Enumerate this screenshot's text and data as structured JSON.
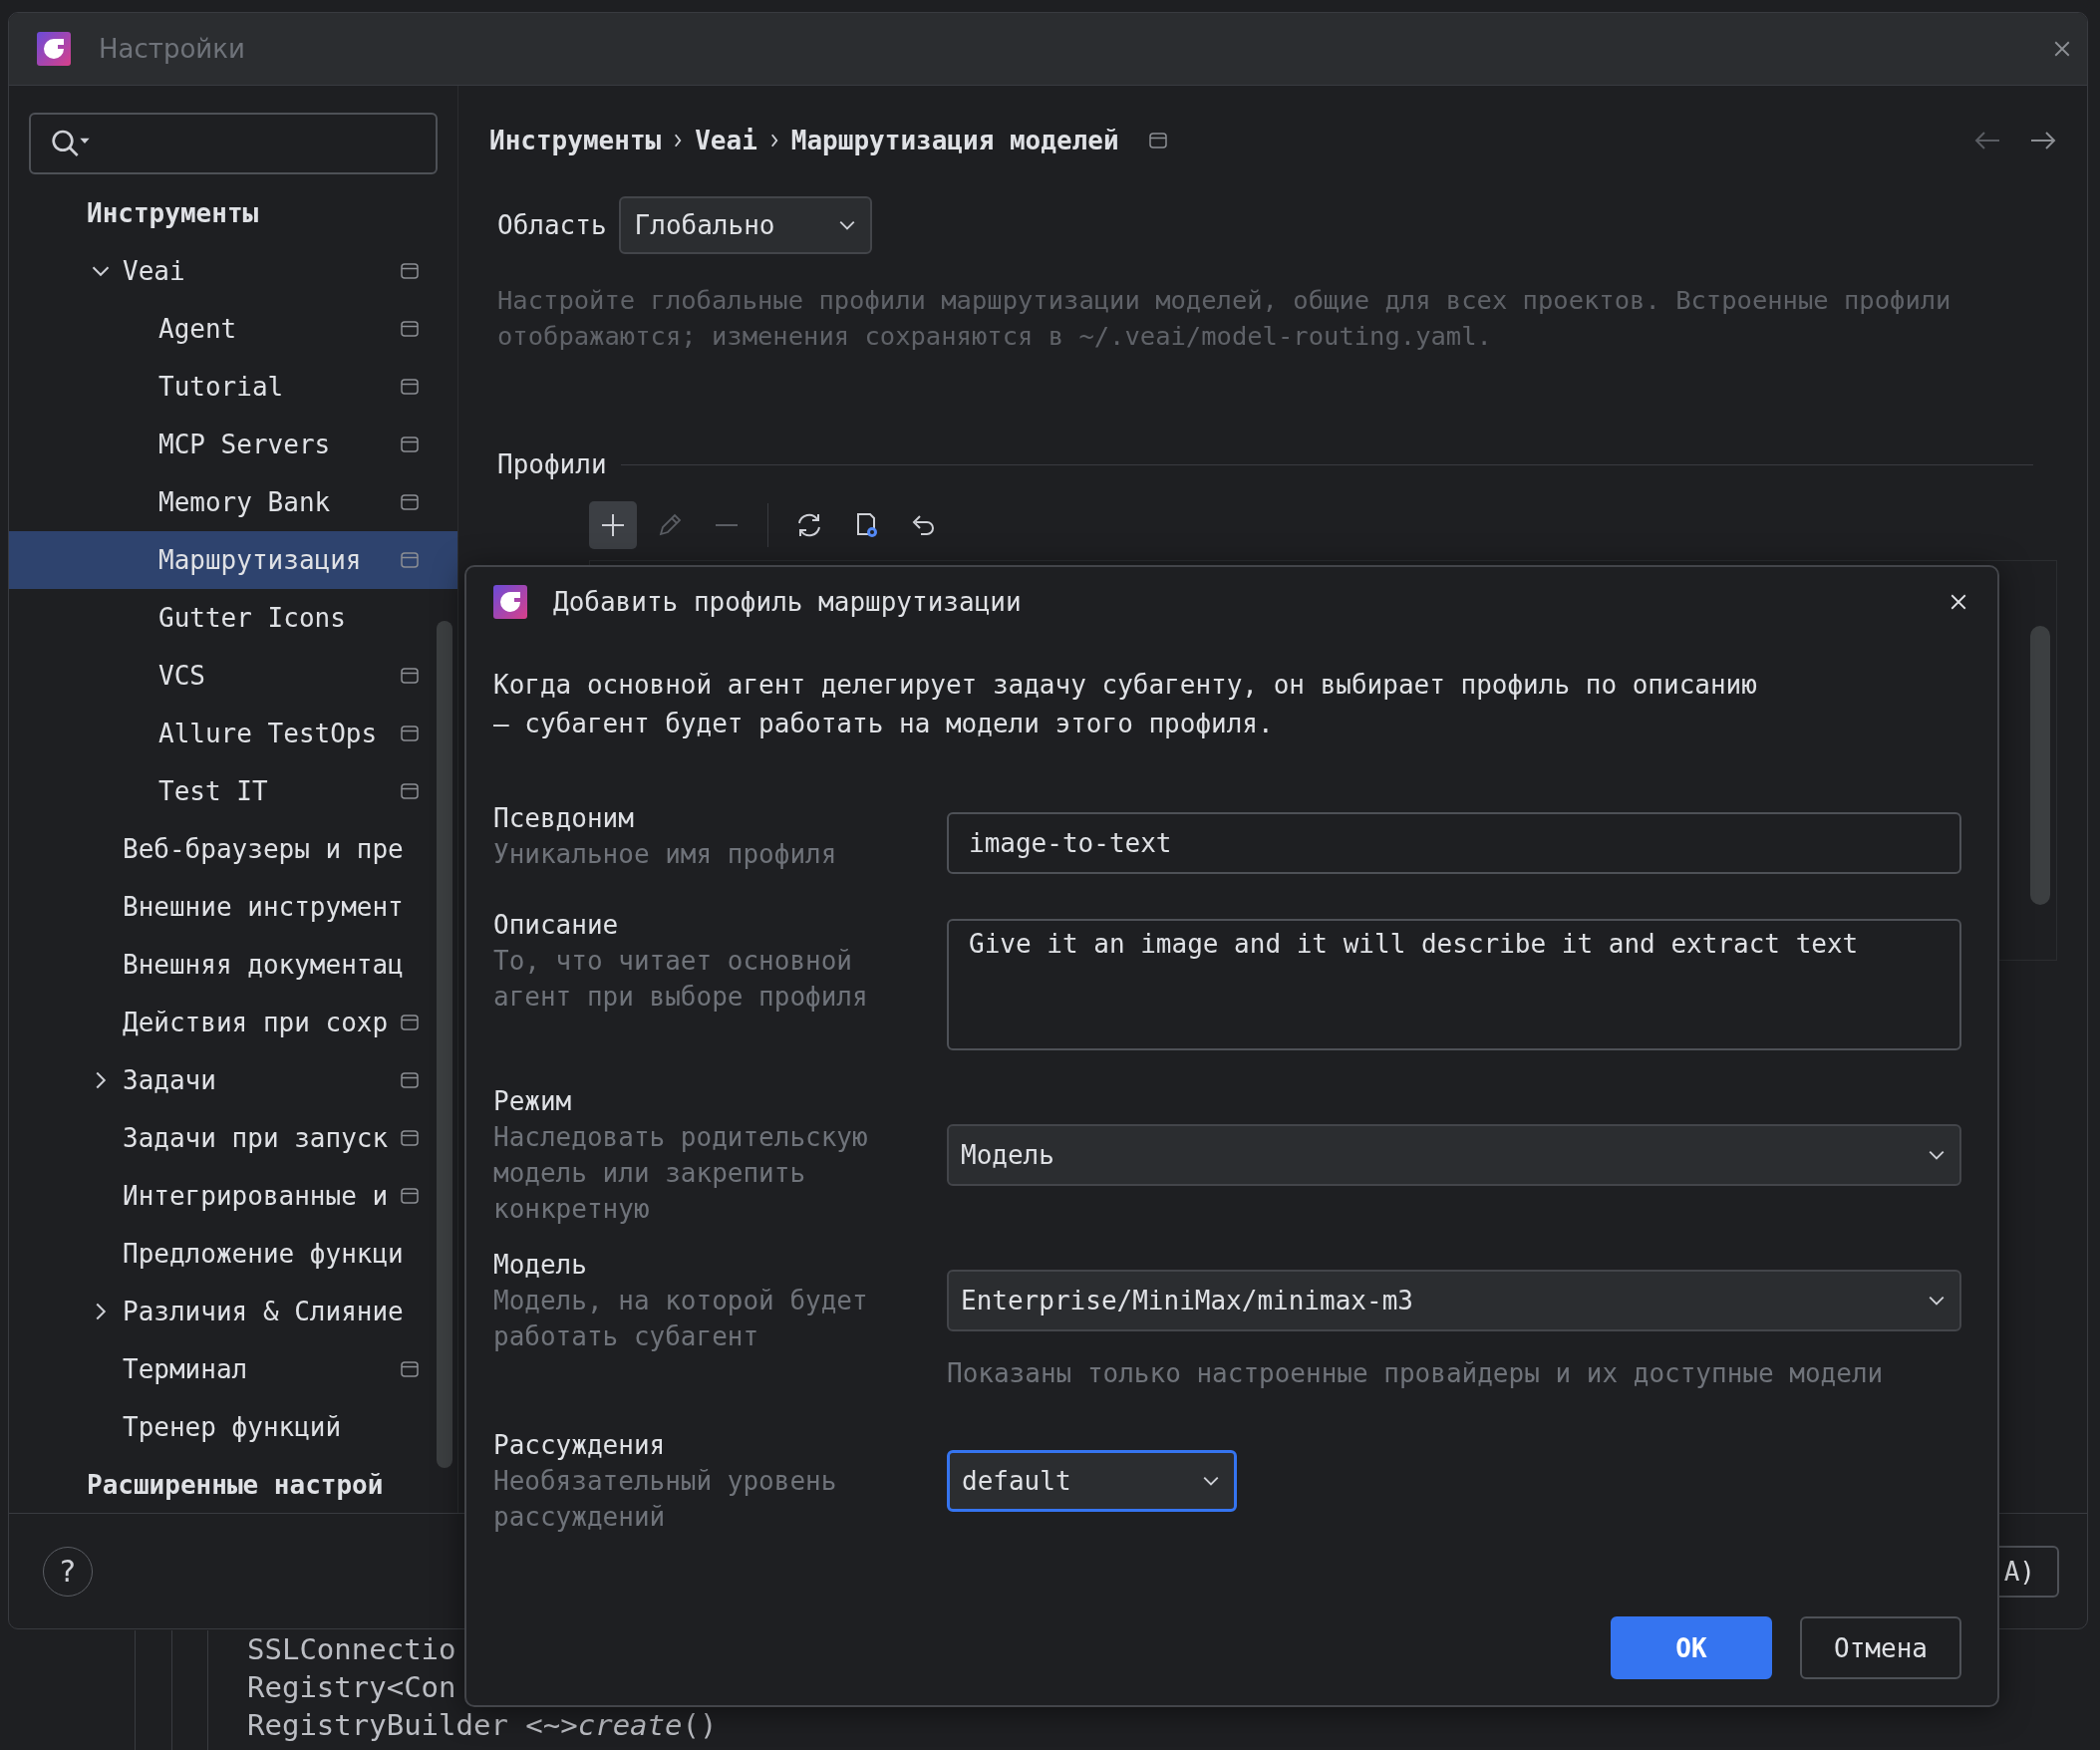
{
  "window": {
    "title": "Настройки"
  },
  "sidebar": {
    "items": [
      {
        "label": "Инструменты",
        "kind": "group",
        "scope_icon": false,
        "selected": false,
        "children": [
          {
            "label": "Veai",
            "kind": "item",
            "expanded": true,
            "scope_icon": true,
            "selected": false,
            "children": [
              {
                "label": "Agent",
                "kind": "item",
                "scope_icon": true,
                "selected": false
              },
              {
                "label": "Tutorial",
                "kind": "item",
                "scope_icon": true,
                "selected": false
              },
              {
                "label": "MCP Servers",
                "kind": "item",
                "scope_icon": true,
                "selected": false
              },
              {
                "label": "Memory Bank",
                "kind": "item",
                "scope_icon": true,
                "selected": false
              },
              {
                "label": "Маршрутизация",
                "kind": "item",
                "scope_icon": true,
                "selected": true
              },
              {
                "label": "Gutter Icons",
                "kind": "item",
                "scope_icon": false,
                "selected": false
              },
              {
                "label": "VCS",
                "kind": "item",
                "scope_icon": true,
                "selected": false
              },
              {
                "label": "Allure TestOps",
                "kind": "item",
                "scope_icon": true,
                "selected": false
              },
              {
                "label": "Test IT",
                "kind": "item",
                "scope_icon": true,
                "selected": false
              }
            ]
          },
          {
            "label": "Веб-браузеры и пре",
            "kind": "item",
            "scope_icon": false,
            "selected": false
          },
          {
            "label": "Внешние инструмент",
            "kind": "item",
            "scope_icon": false,
            "selected": false
          },
          {
            "label": "Внешняя документац",
            "kind": "item",
            "scope_icon": false,
            "selected": false
          },
          {
            "label": "Действия при сохр",
            "kind": "item",
            "scope_icon": true,
            "selected": false
          },
          {
            "label": "Задачи",
            "kind": "item",
            "expanded": false,
            "scope_icon": true,
            "selected": false
          },
          {
            "label": "Задачи при запуск",
            "kind": "item",
            "scope_icon": true,
            "selected": false
          },
          {
            "label": "Интегрированные и",
            "kind": "item",
            "scope_icon": true,
            "selected": false
          },
          {
            "label": "Предложение функци",
            "kind": "item",
            "scope_icon": false,
            "selected": false
          },
          {
            "label": "Различия & Слияние",
            "kind": "item",
            "expanded": false,
            "scope_icon": false,
            "selected": false
          },
          {
            "label": "Терминал",
            "kind": "item",
            "scope_icon": true,
            "selected": false
          },
          {
            "label": "Тренер функций",
            "kind": "item",
            "scope_icon": false,
            "selected": false
          }
        ]
      },
      {
        "label": "Расширенные настрой",
        "kind": "group",
        "scope_icon": false,
        "selected": false
      }
    ]
  },
  "breadcrumb": [
    "Инструменты",
    "Veai",
    "Маршрутизация моделей"
  ],
  "scope": {
    "label": "Область",
    "value": "Глобально"
  },
  "description": "Настройте глобальные профили маршрутизации моделей, общие для всех проектов. Встроенные профили\nотображаются; изменения сохраняются в ~/.veai/model-routing.yaml.",
  "profiles": {
    "title": "Профили",
    "tools": [
      {
        "kind": "add",
        "disabled": false
      },
      {
        "kind": "edit",
        "disabled": true
      },
      {
        "kind": "remove",
        "disabled": true
      },
      {
        "kind": "separator"
      },
      {
        "kind": "refresh",
        "disabled": false
      },
      {
        "kind": "settings-file",
        "disabled": false
      },
      {
        "kind": "undo",
        "disabled": false
      }
    ]
  },
  "footer": {
    "help": "?",
    "partial_button": "A)"
  },
  "editor": {
    "lines": [
      "SSLConnectio",
      "Registry<Con",
      "RegistryBuilder <~>*create*()"
    ]
  },
  "dialog": {
    "title": "Добавить профиль маршрутизации",
    "intro": "Когда основной агент делегирует задачу субагенту, он выбирает профиль по описанию\n— субагент будет работать на модели этого профиля.",
    "fields": [
      {
        "kind": "text",
        "label": "Псевдоним",
        "hint": "Уникальное имя профиля",
        "value": "image-to-text",
        "focused": false
      },
      {
        "kind": "textarea",
        "label": "Описание",
        "hint": "То, что читает основной\nагент при выборе профиля",
        "value": "Give it an image and it will describe it and extract text",
        "focused": false
      },
      {
        "kind": "select",
        "label": "Режим",
        "hint": "Наследовать родительскую\nмодель или закрепить\nконкретную",
        "value": "Модель",
        "focused": false
      },
      {
        "kind": "select",
        "label": "Модель",
        "hint": "Модель, на которой будет\nработать субагент",
        "value": "Enterprise/MiniMax/minimax-m3",
        "note": "Показаны только настроенные провайдеры и их доступные модели",
        "focused": false
      },
      {
        "kind": "select-small",
        "label": "Рассуждения",
        "hint": "Необязательный уровень\nрассуждений",
        "value": "default",
        "focused": true
      }
    ],
    "buttons": [
      {
        "label": "OK",
        "kind": "primary"
      },
      {
        "label": "Отмена",
        "kind": "secondary"
      }
    ]
  }
}
